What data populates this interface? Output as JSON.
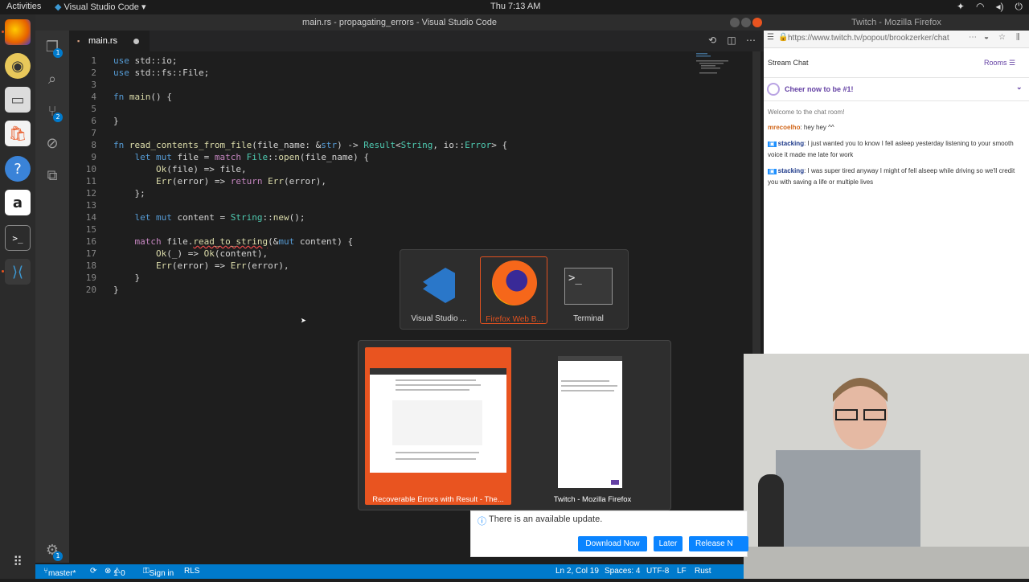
{
  "top_panel": {
    "activities": "Activities",
    "app_menu": "Visual Studio Code",
    "clock": "Thu  7:13 AM"
  },
  "vscode": {
    "title": "main.rs - propagating_errors - Visual Studio Code",
    "tab_label": "main.rs",
    "explorer_badge": "1",
    "scm_badge": "2",
    "settings_badge": "1",
    "code_lines": [
      {
        "n": "1",
        "text": "use std::io;"
      },
      {
        "n": "2",
        "text": "use std::fs::File;"
      },
      {
        "n": "3",
        "text": ""
      },
      {
        "n": "4",
        "text": "fn main() {"
      },
      {
        "n": "5",
        "text": ""
      },
      {
        "n": "6",
        "text": "}"
      },
      {
        "n": "7",
        "text": ""
      },
      {
        "n": "8",
        "text": "fn read_contents_from_file(file_name: &str) -> Result<String, io::Error> {"
      },
      {
        "n": "9",
        "text": "    let mut file = match File::open(file_name) {"
      },
      {
        "n": "10",
        "text": "        Ok(file) => file,"
      },
      {
        "n": "11",
        "text": "        Err(error) => return Err(error),"
      },
      {
        "n": "12",
        "text": "    };"
      },
      {
        "n": "13",
        "text": ""
      },
      {
        "n": "14",
        "text": "    let mut content = String::new();"
      },
      {
        "n": "15",
        "text": ""
      },
      {
        "n": "16",
        "text": "    match file.read_to_string(&mut content) {"
      },
      {
        "n": "17",
        "text": "        Ok(_) => Ok(content),"
      },
      {
        "n": "18",
        "text": "        Err(error) => Err(error),"
      },
      {
        "n": "19",
        "text": "    }"
      },
      {
        "n": "20",
        "text": "}"
      }
    ],
    "status": {
      "branch": "master*",
      "errors": "1",
      "warnings": "0",
      "sign_in": "Sign in",
      "rls": "RLS",
      "position": "Ln 2, Col 19",
      "spaces": "Spaces: 4",
      "encoding": "UTF-8",
      "eol": "LF",
      "language": "Rust"
    }
  },
  "firefox": {
    "title": "Twitch - Mozilla Firefox",
    "url": "https://www.twitch.tv/popout/brookzerker/chat",
    "chat_title": "Stream Chat",
    "rooms": "Rooms",
    "cheer": "Cheer now to be #1!",
    "welcome": "Welcome to the chat room!",
    "messages": [
      {
        "user": "mrecoelho",
        "text": ": hey hey ^^"
      },
      {
        "user": "stacking",
        "text": ": I just wanted you to know I fell asleep yesterday listening to your smooth voice it made me late for work"
      },
      {
        "user": "stacking",
        "text": ": I was super tired anyway I might of fell alseep while driving so we'll credit you with saving a life or multiple lives"
      }
    ]
  },
  "update_bar": {
    "message": "There is an available update.",
    "download": "Download Now",
    "later": "Later",
    "release": "Release N"
  },
  "switcher": {
    "apps": [
      {
        "label": "Visual Studio ..."
      },
      {
        "label": "Firefox Web B..."
      },
      {
        "label": "Terminal"
      }
    ],
    "windows": [
      {
        "label": "Recoverable Errors with Result - The..."
      },
      {
        "label": "Twitch - Mozilla Firefox"
      }
    ]
  }
}
